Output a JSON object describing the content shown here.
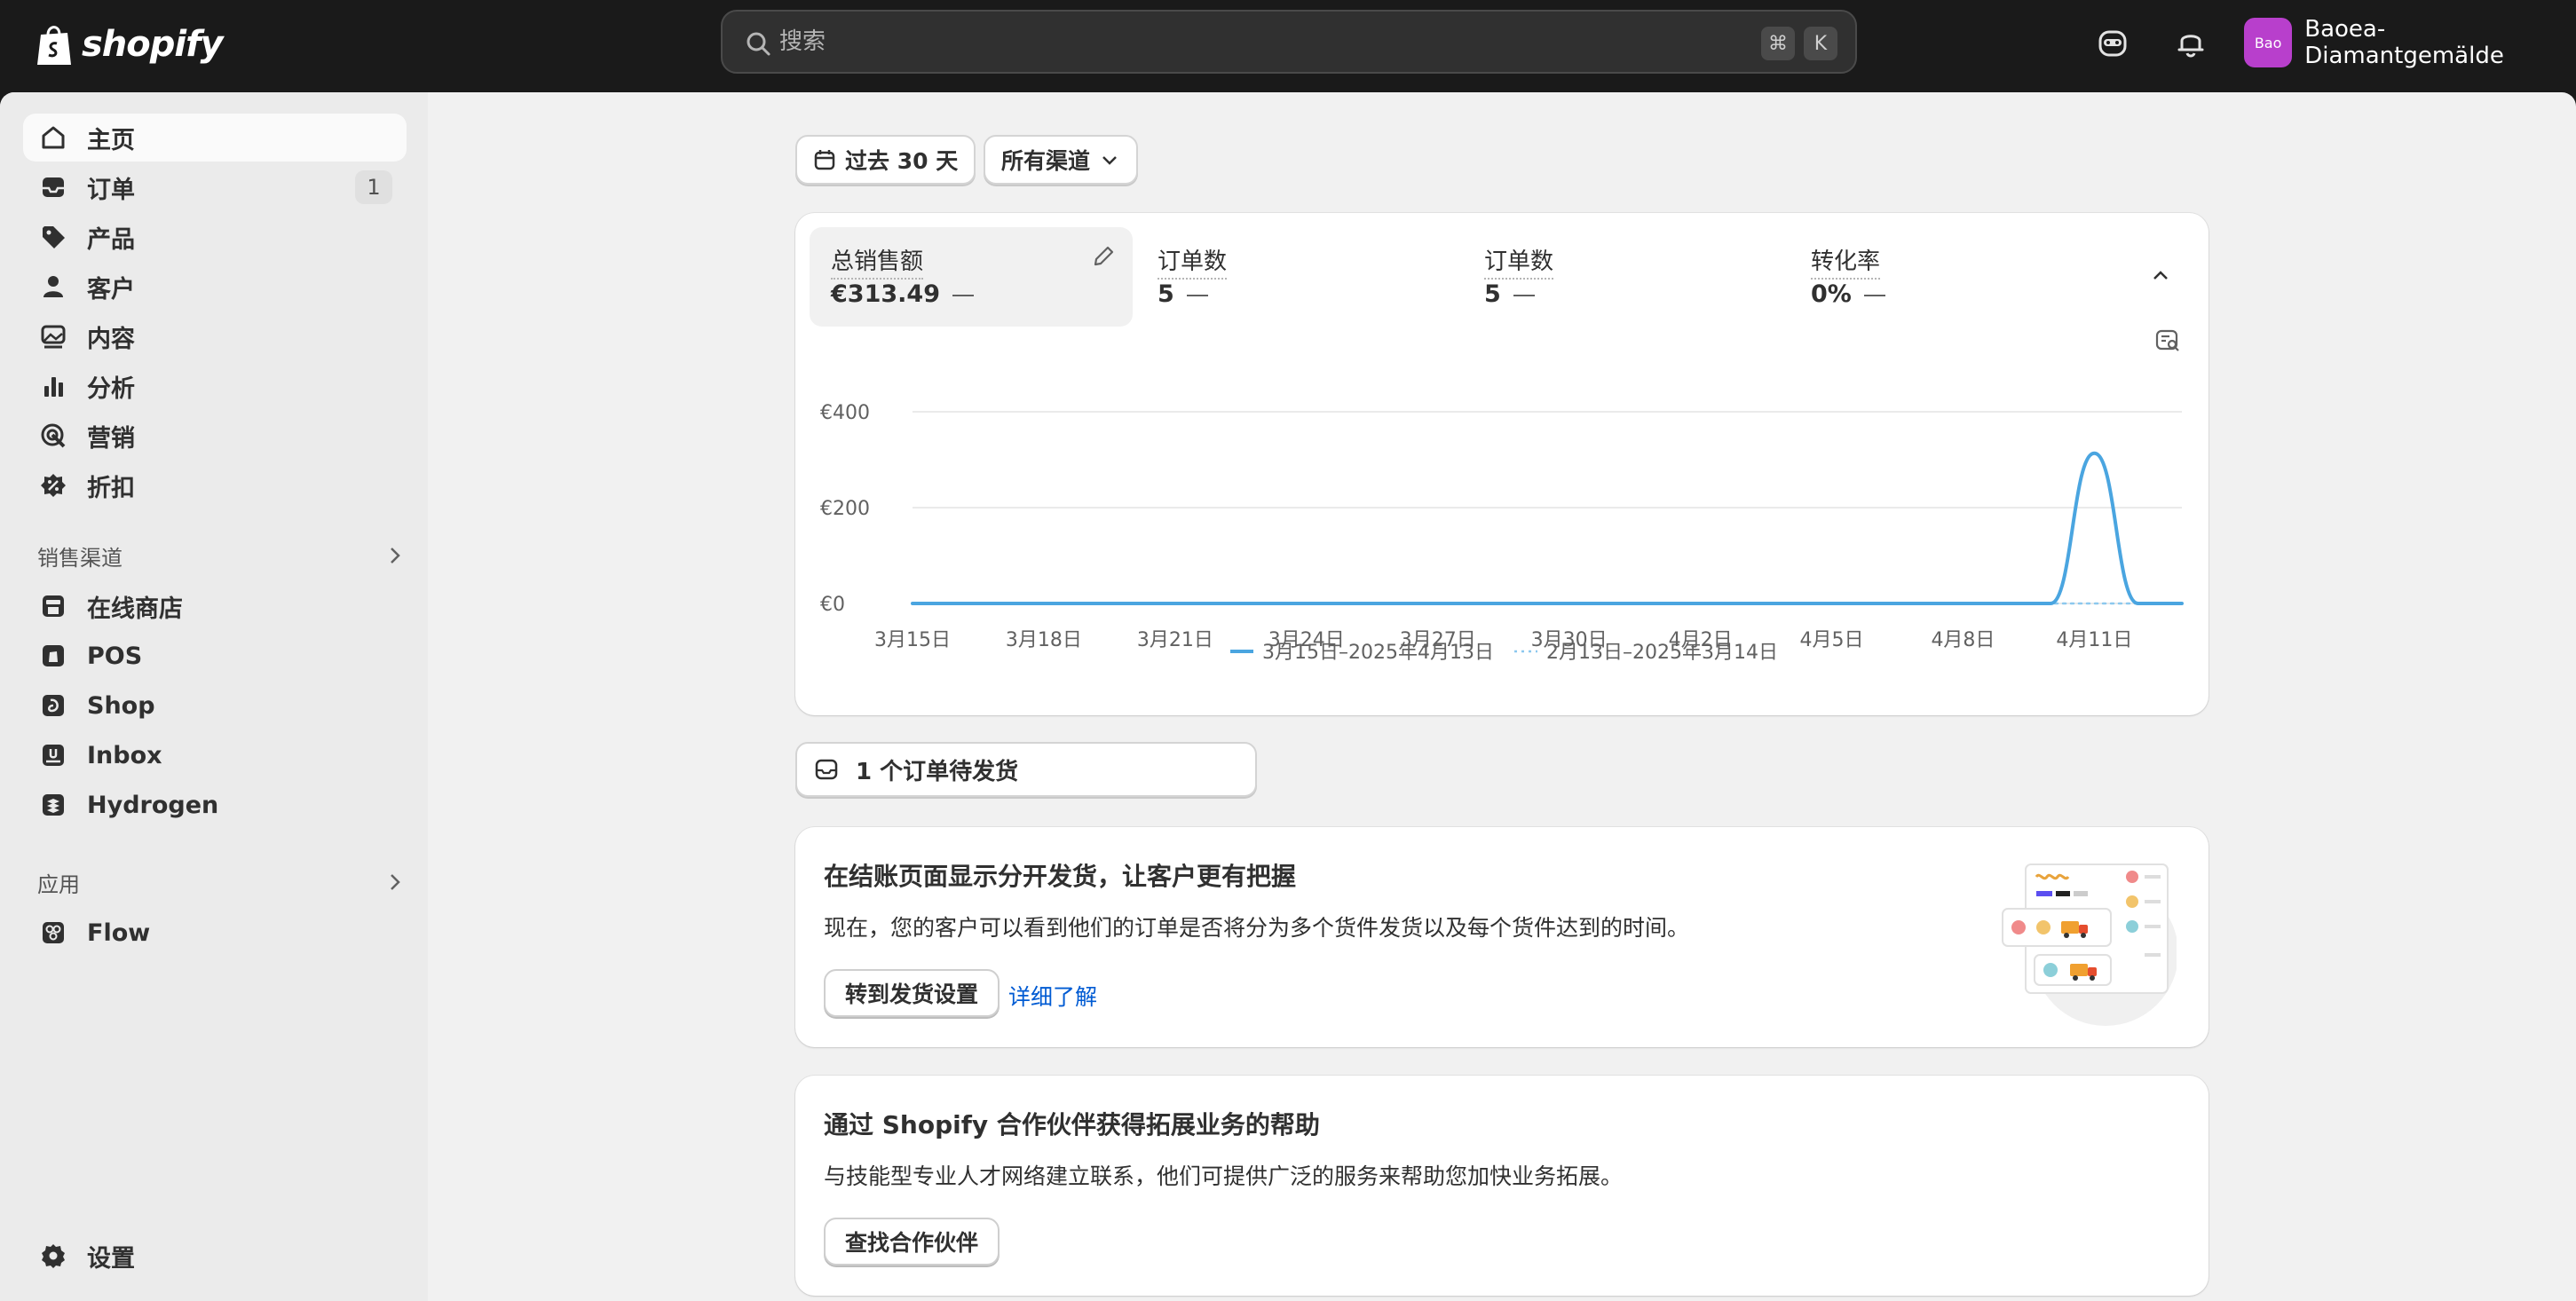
{
  "topbar": {
    "logo_text": "shopify",
    "search_placeholder": "搜索",
    "kbd_cmd": "⌘",
    "kbd_k": "K",
    "avatar_initials": "Bao",
    "store_name": "Baoea-Diamantgemälde"
  },
  "sidebar": {
    "main_items": [
      {
        "label": "主页",
        "icon": "home-icon",
        "active": true
      },
      {
        "label": "订单",
        "icon": "inbox-icon",
        "badge": "1"
      },
      {
        "label": "产品",
        "icon": "tag-icon"
      },
      {
        "label": "客户",
        "icon": "person-icon"
      },
      {
        "label": "内容",
        "icon": "image-icon"
      },
      {
        "label": "分析",
        "icon": "bar-chart-icon"
      },
      {
        "label": "营销",
        "icon": "target-icon"
      },
      {
        "label": "折扣",
        "icon": "discount-icon"
      }
    ],
    "sales_channels_label": "销售渠道",
    "channels": [
      {
        "label": "在线商店",
        "icon": "store-icon"
      },
      {
        "label": "POS",
        "icon": "pos-icon"
      },
      {
        "label": "Shop",
        "icon": "shop-icon"
      },
      {
        "label": "Inbox",
        "icon": "inbox-app-icon"
      },
      {
        "label": "Hydrogen",
        "icon": "hydrogen-icon"
      }
    ],
    "apps_label": "应用",
    "apps": [
      {
        "label": "Flow",
        "icon": "flow-icon"
      }
    ],
    "settings_label": "设置"
  },
  "filters": {
    "date_range": "过去 30 天",
    "channel": "所有渠道"
  },
  "metrics": [
    {
      "label": "总销售额",
      "value": "€313.49"
    },
    {
      "label": "订单数",
      "value": "5"
    },
    {
      "label": "订单数",
      "value": "5"
    },
    {
      "label": "转化率",
      "value": "0%"
    }
  ],
  "chart_data": {
    "type": "line",
    "x": [
      "3月15日",
      "3月16日",
      "3月17日",
      "3月18日",
      "3月19日",
      "3月20日",
      "3月21日",
      "3月22日",
      "3月23日",
      "3月24日",
      "3月25日",
      "3月26日",
      "3月27日",
      "3月28日",
      "3月29日",
      "3月30日",
      "3月31日",
      "4月1日",
      "4月2日",
      "4月3日",
      "4月4日",
      "4月5日",
      "4月6日",
      "4月7日",
      "4月8日",
      "4月9日",
      "4月10日",
      "4月11日",
      "4月12日",
      "4月13日"
    ],
    "tick_labels": [
      "3月15日",
      "3月18日",
      "3月21日",
      "3月24日",
      "3月27日",
      "3月30日",
      "4月2日",
      "4月5日",
      "4月8日",
      "4月11日"
    ],
    "series": [
      {
        "name": "3月15日–2025年4月13日",
        "color": "#4aa5e0",
        "style": "solid",
        "values": [
          0,
          0,
          0,
          0,
          0,
          0,
          0,
          0,
          0,
          0,
          0,
          0,
          0,
          0,
          0,
          0,
          0,
          0,
          0,
          0,
          0,
          0,
          0,
          0,
          0,
          0,
          0,
          313.49,
          0,
          0
        ]
      },
      {
        "name": "2月13日–2025年3月14日",
        "color": "#8cc8ee",
        "style": "dotted",
        "values": [
          0,
          0,
          0,
          0,
          0,
          0,
          0,
          0,
          0,
          0,
          0,
          0,
          0,
          0,
          0,
          0,
          0,
          0,
          0,
          0,
          0,
          0,
          0,
          0,
          0,
          0,
          0,
          0,
          0,
          0
        ]
      }
    ],
    "yticks": [
      "€0",
      "€200",
      "€400"
    ],
    "ylim": [
      0,
      400
    ],
    "grid": true,
    "legend_position": "bottom-center"
  },
  "orders_pending": "1 个订单待发货",
  "promo1": {
    "title": "在结账页面显示分开发货，让客户更有把握",
    "text": "现在，您的客户可以看到他们的订单是否将分为多个货件发货以及每个货件达到的时间。",
    "button": "转到发货设置",
    "link": "详细了解"
  },
  "promo2": {
    "title": "通过 Shopify 合作伙伴获得拓展业务的帮助",
    "text": "与技能型专业人才网络建立联系，他们可提供广泛的服务来帮助您加快业务拓展。",
    "button": "查找合作伙伴"
  }
}
